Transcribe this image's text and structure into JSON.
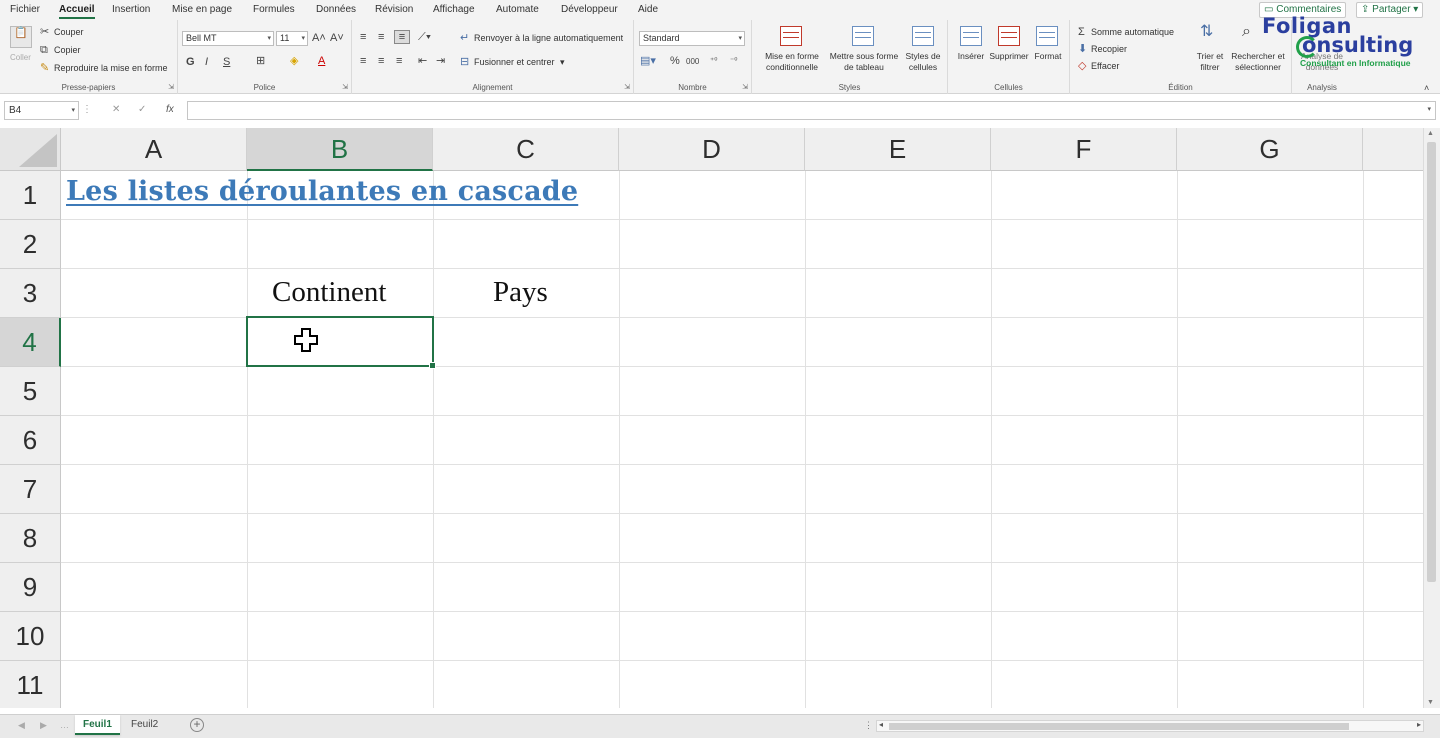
{
  "tabs": [
    "Fichier",
    "Accueil",
    "Insertion",
    "Mise en page",
    "Formules",
    "Données",
    "Révision",
    "Affichage",
    "Automate",
    "Développeur",
    "Aide"
  ],
  "active_tab": "Accueil",
  "top_buttons": {
    "comments": "Commentaires",
    "share": "Partager"
  },
  "ribbon": {
    "clipboard": {
      "paste": "Coller",
      "cut": "Couper",
      "copy": "Copier",
      "format_painter": "Reproduire la mise en forme",
      "label": "Presse-papiers"
    },
    "font": {
      "name": "Bell MT",
      "size": "11",
      "bold": "G",
      "italic": "I",
      "underline": "S",
      "label": "Police"
    },
    "alignment": {
      "wrap": "Renvoyer à la ligne automatiquement",
      "merge": "Fusionner et centrer",
      "label": "Alignement"
    },
    "number": {
      "format": "Standard",
      "label": "Nombre"
    },
    "styles": {
      "cond_format": "Mise en forme conditionnelle",
      "table": "Mettre sous forme de tableau",
      "cell_styles": "Styles de cellules",
      "label": "Styles"
    },
    "cells": {
      "insert": "Insérer",
      "delete": "Supprimer",
      "format": "Format",
      "label": "Cellules"
    },
    "editing": {
      "autosum": "Somme automatique",
      "fill": "Recopier",
      "clear": "Effacer",
      "sort": "Trier et filtrer",
      "find": "Rechercher et sélectionner",
      "label": "Édition"
    },
    "analysis": {
      "analyze": "Analyse de données",
      "label": "Analysis"
    }
  },
  "logo": {
    "line1": "Foligan",
    "line2": "onsulting",
    "tagline": "Consultant en Informatique"
  },
  "formula_bar": {
    "name_box": "B4",
    "fx": "fx",
    "content": ""
  },
  "columns": [
    "A",
    "B",
    "C",
    "D",
    "E",
    "F",
    "G"
  ],
  "selected_column": "B",
  "rows": [
    "1",
    "2",
    "3",
    "4",
    "5",
    "6",
    "7",
    "8",
    "9",
    "10",
    "11"
  ],
  "selected_row": "4",
  "cells": {
    "A1": "Les listes déroulantes en cascade",
    "B3": "Continent",
    "C3": "Pays"
  },
  "sheets": [
    "Feuil1",
    "Feuil2"
  ],
  "active_sheet": "Feuil1",
  "colors": {
    "accent": "#217346",
    "title": "#3d7ab8",
    "logo_blue": "#2b3f9f",
    "logo_green": "#21a04a"
  }
}
